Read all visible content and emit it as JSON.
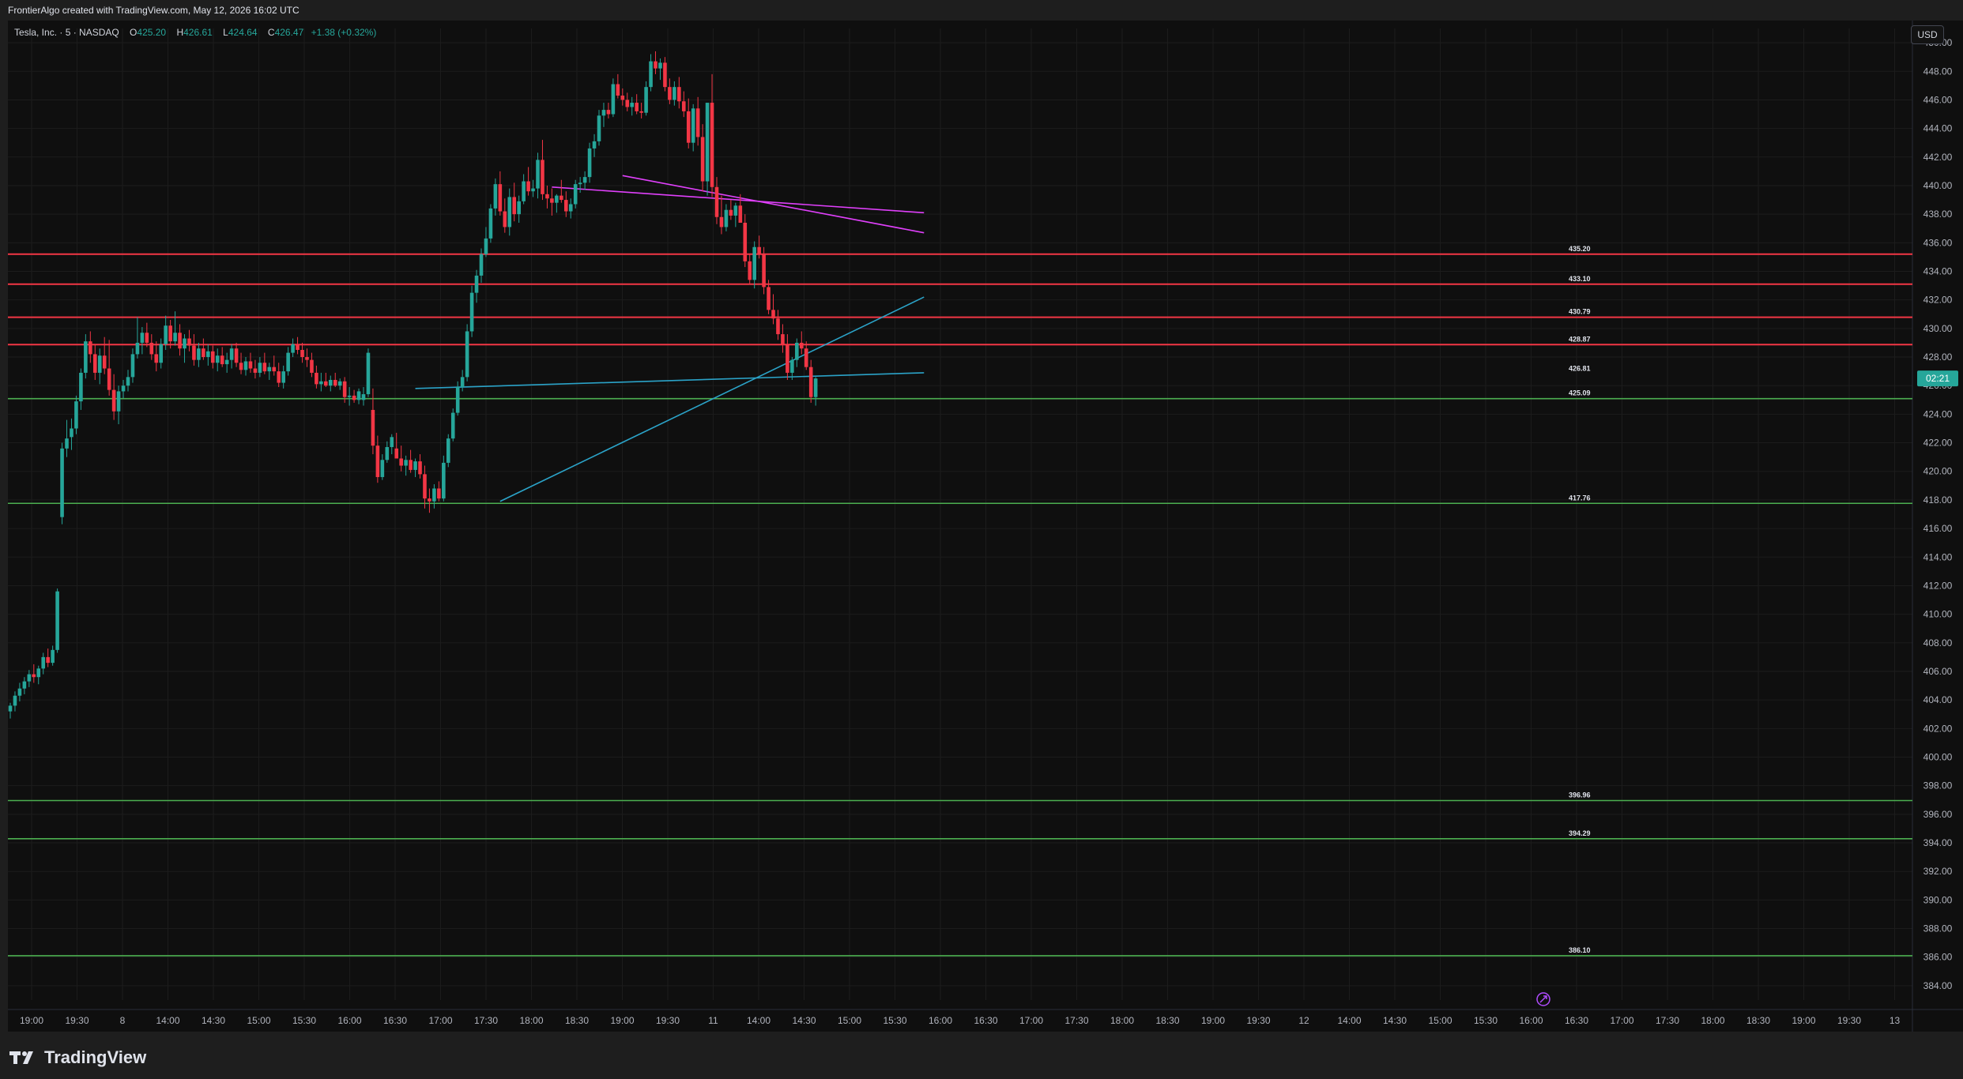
{
  "header": {
    "attribution": "FrontierAlgo created with TradingView.com, May 12, 2026 16:02 UTC"
  },
  "legend": {
    "symbol": "Tesla, Inc. · 5 · NASDAQ",
    "o_label": "O",
    "o_value": "425.20",
    "h_label": "H",
    "h_value": "426.61",
    "l_label": "L",
    "l_value": "424.64",
    "c_label": "C",
    "c_value": "426.47",
    "change": "+1.38 (+0.32%)"
  },
  "currency": "USD",
  "countdown": "02:21",
  "brand": {
    "name": "TradingView"
  },
  "colors": {
    "up": "#26a69a",
    "down": "#f23645",
    "res": "#f23645",
    "sup": "#4caf50",
    "trend_magenta": "#e040fb",
    "trend_cyan": "#2ba3c8",
    "background": "#0f0f0f"
  },
  "chart_data": {
    "type": "candlestick",
    "ylim": [
      383,
      451
    ],
    "y_ticks": [
      "384.00",
      "386.00",
      "388.00",
      "390.00",
      "392.00",
      "394.00",
      "396.00",
      "398.00",
      "400.00",
      "402.00",
      "404.00",
      "406.00",
      "408.00",
      "410.00",
      "412.00",
      "414.00",
      "416.00",
      "418.00",
      "420.00",
      "422.00",
      "424.00",
      "426.00",
      "428.00",
      "430.00",
      "432.00",
      "434.00",
      "436.00",
      "438.00",
      "440.00",
      "442.00",
      "444.00",
      "446.00",
      "448.00",
      "450.00"
    ],
    "x_ticks": [
      "19:00",
      "19:30",
      "8",
      "14:00",
      "14:30",
      "15:00",
      "15:30",
      "16:00",
      "16:30",
      "17:00",
      "17:30",
      "18:00",
      "18:30",
      "19:00",
      "19:30",
      "11",
      "14:00",
      "14:30",
      "15:00",
      "15:30",
      "16:00",
      "16:30",
      "17:00",
      "17:30",
      "18:00",
      "18:30",
      "19:00",
      "19:30",
      "12",
      "14:00",
      "14:30",
      "15:00",
      "15:30",
      "16:00",
      "16:30",
      "17:00",
      "17:30",
      "18:00",
      "18:30",
      "19:00",
      "19:30",
      "13"
    ],
    "levels": [
      {
        "label": "435.20",
        "price": 435.2,
        "kind": "res"
      },
      {
        "label": "433.10",
        "price": 433.1,
        "kind": "res"
      },
      {
        "label": "430.79",
        "price": 430.79,
        "kind": "res"
      },
      {
        "label": "428.87",
        "price": 428.87,
        "kind": "res"
      },
      {
        "label": "426.81",
        "price": 426.81,
        "kind": "none"
      },
      {
        "label": "425.09",
        "price": 425.09,
        "kind": "sup"
      },
      {
        "label": "417.76",
        "price": 417.76,
        "kind": "sup"
      },
      {
        "label": "396.96",
        "price": 396.96,
        "kind": "sup"
      },
      {
        "label": "394.29",
        "price": 394.29,
        "kind": "sup"
      },
      {
        "label": "386.10",
        "price": 386.1,
        "kind": "sup"
      }
    ],
    "trendlines": [
      {
        "kind": "magenta",
        "points": [
          [
            130,
            440.7
          ],
          [
            194,
            436.7
          ]
        ]
      },
      {
        "kind": "magenta",
        "points": [
          [
            115,
            439.9
          ],
          [
            194,
            438.1
          ]
        ]
      },
      {
        "kind": "cyan",
        "points": [
          [
            104,
            417.9
          ],
          [
            194,
            432.2
          ]
        ]
      },
      {
        "kind": "cyan",
        "points": [
          [
            86,
            425.8
          ],
          [
            194,
            426.9
          ]
        ]
      }
    ],
    "candles": [
      [
        403.2,
        403.8,
        402.7,
        403.6
      ],
      [
        403.6,
        404.6,
        403.2,
        404.3
      ],
      [
        404.3,
        405.2,
        403.9,
        404.8
      ],
      [
        404.8,
        405.6,
        404.4,
        405.3
      ],
      [
        405.3,
        406.1,
        404.9,
        405.8
      ],
      [
        405.8,
        406.5,
        405.2,
        405.6
      ],
      [
        405.6,
        406.4,
        405.1,
        406.2
      ],
      [
        406.2,
        407.3,
        405.8,
        407.0
      ],
      [
        407.0,
        407.6,
        406.3,
        406.6
      ],
      [
        406.6,
        407.8,
        406.4,
        407.5
      ],
      [
        407.5,
        411.8,
        407.3,
        411.6
      ],
      [
        416.8,
        422.0,
        416.3,
        421.6
      ],
      [
        421.6,
        423.6,
        421.0,
        422.3
      ],
      [
        422.4,
        423.7,
        421.5,
        423.0
      ],
      [
        423.0,
        425.3,
        422.6,
        424.9
      ],
      [
        424.9,
        427.2,
        424.3,
        426.9
      ],
      [
        426.9,
        429.6,
        426.5,
        429.1
      ],
      [
        429.1,
        429.8,
        427.6,
        428.2
      ],
      [
        428.2,
        428.9,
        426.4,
        426.9
      ],
      [
        426.9,
        428.6,
        426.1,
        428.1
      ],
      [
        428.1,
        429.4,
        426.8,
        427.2
      ],
      [
        427.2,
        429.2,
        425.3,
        425.7
      ],
      [
        425.7,
        426.8,
        423.6,
        424.2
      ],
      [
        424.2,
        426.0,
        423.3,
        425.6
      ],
      [
        425.6,
        426.4,
        425.1,
        426.0
      ],
      [
        426.0,
        427.1,
        425.6,
        426.6
      ],
      [
        426.6,
        428.6,
        426.2,
        428.2
      ],
      [
        428.2,
        430.8,
        427.9,
        429.0
      ],
      [
        429.0,
        430.1,
        428.2,
        429.7
      ],
      [
        429.7,
        430.4,
        428.7,
        429.0
      ],
      [
        429.0,
        429.6,
        427.8,
        428.2
      ],
      [
        428.2,
        429.1,
        427.0,
        427.6
      ],
      [
        427.6,
        429.3,
        427.2,
        428.9
      ],
      [
        428.9,
        430.9,
        428.5,
        430.2
      ],
      [
        430.2,
        430.6,
        428.6,
        429.1
      ],
      [
        429.1,
        431.2,
        428.8,
        429.7
      ],
      [
        429.7,
        430.3,
        428.1,
        428.6
      ],
      [
        428.6,
        429.6,
        427.6,
        429.3
      ],
      [
        429.3,
        429.9,
        428.4,
        428.8
      ],
      [
        428.8,
        429.6,
        427.4,
        427.8
      ],
      [
        427.8,
        429.0,
        427.3,
        428.6
      ],
      [
        428.6,
        429.3,
        427.8,
        428.0
      ],
      [
        428.0,
        428.9,
        427.4,
        428.4
      ],
      [
        428.4,
        428.8,
        427.2,
        427.6
      ],
      [
        427.6,
        428.6,
        427.0,
        428.1
      ],
      [
        428.1,
        428.7,
        427.3,
        427.5
      ],
      [
        427.5,
        428.3,
        426.9,
        427.8
      ],
      [
        427.8,
        428.9,
        427.2,
        428.6
      ],
      [
        428.6,
        429.0,
        427.3,
        427.6
      ],
      [
        427.6,
        428.3,
        426.8,
        427.1
      ],
      [
        427.1,
        428.0,
        426.7,
        427.7
      ],
      [
        427.7,
        428.3,
        426.9,
        427.2
      ],
      [
        427.2,
        427.8,
        426.5,
        426.9
      ],
      [
        426.9,
        428.0,
        426.6,
        427.6
      ],
      [
        427.6,
        428.3,
        426.8,
        427.0
      ],
      [
        427.0,
        427.6,
        426.4,
        427.3
      ],
      [
        427.3,
        428.1,
        426.7,
        427.0
      ],
      [
        427.0,
        427.6,
        425.9,
        426.2
      ],
      [
        426.2,
        427.4,
        425.8,
        427.0
      ],
      [
        427.0,
        428.7,
        426.7,
        428.3
      ],
      [
        428.3,
        429.3,
        428.0,
        428.9
      ],
      [
        428.9,
        429.4,
        428.2,
        428.5
      ],
      [
        428.5,
        429.0,
        427.6,
        428.0
      ],
      [
        428.0,
        428.6,
        427.3,
        427.8
      ],
      [
        427.8,
        428.3,
        426.6,
        426.9
      ],
      [
        426.9,
        427.4,
        425.8,
        426.1
      ],
      [
        426.1,
        426.9,
        425.6,
        426.3
      ],
      [
        426.3,
        426.9,
        425.9,
        426.0
      ],
      [
        426.0,
        426.7,
        425.6,
        426.4
      ],
      [
        426.4,
        426.9,
        425.9,
        426.0
      ],
      [
        426.0,
        426.5,
        425.7,
        426.3
      ],
      [
        426.3,
        426.6,
        424.8,
        425.2
      ],
      [
        425.2,
        425.9,
        424.6,
        425.3
      ],
      [
        425.3,
        425.7,
        424.8,
        425.0
      ],
      [
        425.0,
        425.8,
        424.7,
        425.6
      ],
      [
        425.0,
        425.9,
        424.6,
        425.4
      ],
      [
        425.4,
        428.6,
        425.2,
        428.3
      ],
      [
        424.3,
        425.8,
        421.2,
        421.8
      ],
      [
        421.8,
        422.5,
        419.2,
        419.6
      ],
      [
        419.6,
        421.2,
        419.4,
        420.8
      ],
      [
        420.8,
        422.1,
        420.6,
        421.7
      ],
      [
        421.7,
        422.6,
        421.2,
        422.4
      ],
      [
        421.6,
        422.7,
        421.2,
        420.9
      ],
      [
        420.9,
        421.8,
        420.0,
        420.4
      ],
      [
        420.4,
        421.1,
        419.7,
        420.8
      ],
      [
        420.8,
        421.5,
        419.9,
        420.1
      ],
      [
        420.1,
        420.9,
        419.6,
        420.7
      ],
      [
        420.7,
        421.2,
        419.5,
        419.8
      ],
      [
        419.8,
        420.4,
        417.4,
        418.1
      ],
      [
        418.1,
        418.8,
        417.1,
        417.9
      ],
      [
        417.9,
        419.1,
        417.4,
        418.8
      ],
      [
        418.8,
        419.3,
        417.9,
        418.1
      ],
      [
        418.1,
        421.1,
        417.9,
        420.6
      ],
      [
        420.6,
        422.6,
        420.3,
        422.3
      ],
      [
        422.3,
        424.4,
        422.1,
        424.1
      ],
      [
        424.1,
        426.3,
        423.9,
        425.9
      ],
      [
        425.9,
        427.1,
        425.6,
        426.6
      ],
      [
        426.6,
        430.3,
        426.3,
        429.8
      ],
      [
        429.8,
        433.0,
        429.4,
        432.5
      ],
      [
        432.5,
        434.1,
        431.8,
        433.7
      ],
      [
        433.7,
        435.6,
        433.2,
        435.2
      ],
      [
        435.2,
        437.1,
        435.0,
        436.3
      ],
      [
        436.3,
        438.7,
        436.0,
        438.4
      ],
      [
        438.4,
        440.5,
        437.9,
        440.1
      ],
      [
        440.1,
        441.0,
        437.9,
        438.2
      ],
      [
        438.2,
        439.1,
        436.7,
        437.1
      ],
      [
        437.1,
        439.8,
        436.5,
        439.2
      ],
      [
        439.2,
        440.2,
        437.5,
        438.0
      ],
      [
        438.0,
        439.3,
        437.4,
        438.9
      ],
      [
        438.9,
        440.8,
        438.7,
        440.3
      ],
      [
        440.3,
        441.3,
        439.3,
        439.6
      ],
      [
        439.6,
        440.4,
        439.2,
        439.8
      ],
      [
        439.8,
        442.3,
        439.1,
        441.8
      ],
      [
        441.8,
        443.2,
        439.0,
        439.4
      ],
      [
        439.4,
        440.0,
        438.4,
        439.1
      ],
      [
        439.1,
        439.8,
        437.9,
        438.8
      ],
      [
        438.8,
        439.4,
        438.1,
        439.3
      ],
      [
        439.3,
        440.4,
        438.8,
        439.0
      ],
      [
        439.0,
        439.6,
        437.8,
        438.2
      ],
      [
        438.2,
        439.1,
        437.7,
        438.7
      ],
      [
        438.7,
        440.4,
        438.4,
        440.1
      ],
      [
        440.1,
        440.6,
        439.5,
        440.2
      ],
      [
        440.2,
        441.0,
        439.7,
        440.6
      ],
      [
        440.6,
        443.0,
        440.2,
        442.6
      ],
      [
        442.6,
        443.6,
        442.0,
        443.1
      ],
      [
        443.1,
        445.3,
        442.8,
        444.9
      ],
      [
        444.9,
        445.8,
        444.1,
        445.3
      ],
      [
        445.3,
        445.8,
        444.7,
        445.0
      ],
      [
        445.0,
        447.5,
        444.8,
        447.1
      ],
      [
        447.1,
        447.8,
        446.1,
        446.3
      ],
      [
        446.3,
        446.8,
        445.6,
        446.0
      ],
      [
        446.0,
        446.5,
        445.2,
        445.5
      ],
      [
        445.5,
        446.2,
        444.9,
        445.8
      ],
      [
        445.8,
        446.4,
        445.0,
        445.2
      ],
      [
        445.2,
        445.8,
        444.7,
        445.1
      ],
      [
        445.1,
        447.3,
        444.9,
        446.9
      ],
      [
        446.9,
        449.2,
        446.6,
        448.7
      ],
      [
        448.7,
        449.4,
        447.8,
        448.2
      ],
      [
        448.2,
        448.9,
        447.4,
        448.6
      ],
      [
        448.6,
        449.0,
        446.6,
        446.9
      ],
      [
        446.9,
        447.5,
        445.7,
        446.0
      ],
      [
        446.0,
        447.3,
        445.6,
        446.9
      ],
      [
        446.9,
        447.6,
        445.4,
        445.9
      ],
      [
        445.9,
        446.6,
        444.8,
        445.2
      ],
      [
        445.2,
        446.1,
        442.6,
        443.0
      ],
      [
        443.0,
        445.7,
        442.4,
        445.4
      ],
      [
        445.4,
        446.2,
        442.8,
        443.4
      ],
      [
        443.4,
        444.3,
        439.6,
        440.3
      ],
      [
        440.3,
        444.3,
        439.3,
        445.8
      ],
      [
        445.8,
        447.8,
        439.2,
        439.9
      ],
      [
        439.9,
        440.6,
        437.3,
        437.8
      ],
      [
        437.8,
        439.3,
        436.6,
        437.1
      ],
      [
        437.1,
        438.7,
        436.8,
        438.3
      ],
      [
        438.3,
        439.0,
        437.6,
        437.9
      ],
      [
        437.9,
        438.8,
        437.1,
        438.6
      ],
      [
        438.6,
        439.4,
        437.7,
        437.4
      ],
      [
        437.4,
        438.0,
        434.3,
        434.7
      ],
      [
        434.7,
        435.2,
        433.1,
        433.4
      ],
      [
        433.4,
        436.1,
        432.8,
        435.7
      ],
      [
        435.7,
        436.5,
        434.9,
        435.2
      ],
      [
        435.2,
        435.7,
        432.4,
        432.9
      ],
      [
        432.9,
        433.4,
        431.0,
        431.3
      ],
      [
        431.3,
        432.4,
        430.3,
        430.7
      ],
      [
        430.7,
        431.3,
        429.2,
        429.6
      ],
      [
        429.6,
        430.3,
        428.3,
        428.9
      ],
      [
        428.9,
        429.6,
        426.4,
        426.9
      ],
      [
        426.9,
        428.0,
        426.4,
        427.8
      ],
      [
        427.8,
        429.3,
        427.3,
        429.0
      ],
      [
        429.0,
        429.8,
        428.2,
        428.6
      ],
      [
        428.6,
        429.1,
        427.1,
        427.3
      ],
      [
        427.3,
        427.8,
        424.8,
        425.2
      ],
      [
        425.2,
        426.6,
        424.6,
        426.5
      ]
    ]
  }
}
